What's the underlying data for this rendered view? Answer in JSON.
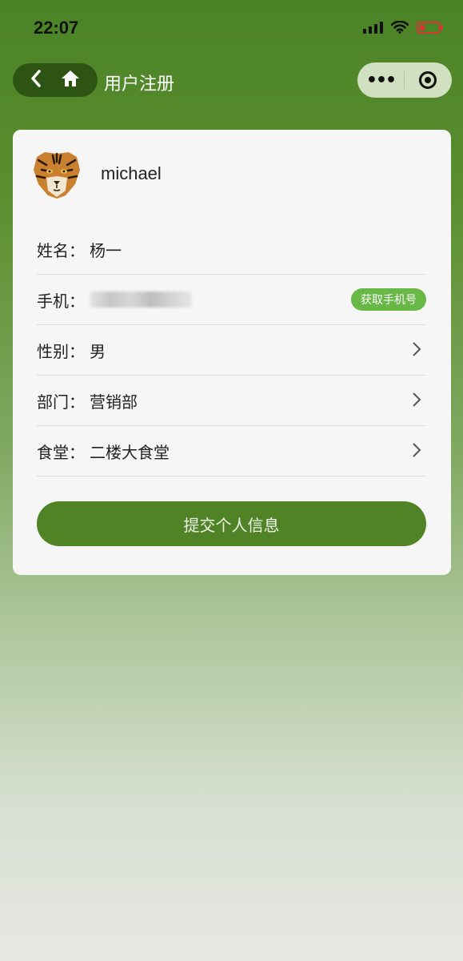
{
  "status_bar": {
    "time": "22:07",
    "icons": [
      "signal-icon",
      "wifi-icon",
      "battery-icon"
    ]
  },
  "nav": {
    "title": "用户注册",
    "back_icon": "back-arrow-icon",
    "home_icon": "home-icon",
    "more_label": "•••",
    "target_icon": "target-icon"
  },
  "profile": {
    "username": "michael",
    "avatar_icon": "tiger-avatar"
  },
  "form": {
    "name": {
      "label": "姓名：",
      "value": "杨一"
    },
    "phone": {
      "label": "手机：",
      "button": "获取手机号"
    },
    "gender": {
      "label": "性别：",
      "value": "男"
    },
    "department": {
      "label": "部门：",
      "value": "营销部"
    },
    "canteen": {
      "label": "食堂：",
      "value": "二楼大食堂"
    }
  },
  "submit_label": "提交个人信息",
  "colors": {
    "theme_green": "#4f8325",
    "button_green": "#68b845"
  }
}
